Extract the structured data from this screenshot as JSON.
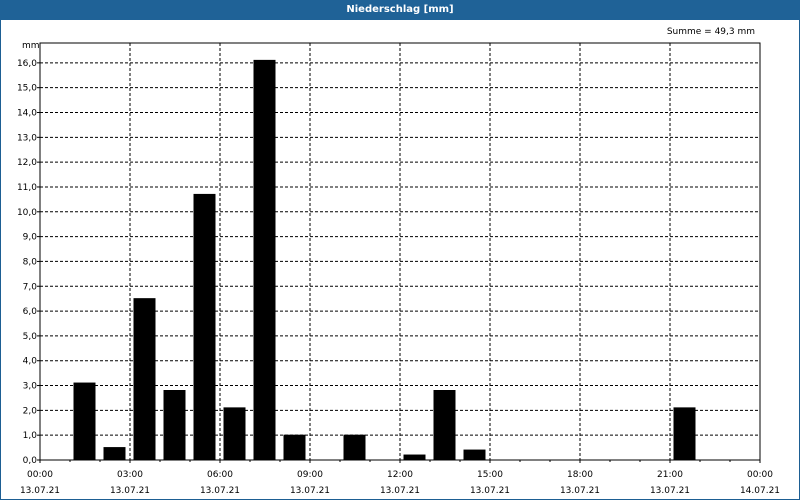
{
  "title": "Niederschlag [mm]",
  "summary": "Summe = 49,3 mm",
  "chart_data": {
    "type": "bar",
    "title": "Niederschlag [mm]",
    "ylabel": "mm",
    "xlabel": "",
    "ylim": [
      0,
      16.8
    ],
    "y_ticks": [
      "0,0",
      "1,0",
      "2,0",
      "3,0",
      "4,0",
      "5,0",
      "6,0",
      "7,0",
      "8,0",
      "9,0",
      "10,0",
      "11,0",
      "12,0",
      "13,0",
      "14,0",
      "15,0",
      "16,0"
    ],
    "x_ticks": [
      {
        "time": "00:00",
        "date": "13.07.21"
      },
      {
        "time": "03:00",
        "date": "13.07.21"
      },
      {
        "time": "06:00",
        "date": "13.07.21"
      },
      {
        "time": "09:00",
        "date": "13.07.21"
      },
      {
        "time": "12:00",
        "date": "13.07.21"
      },
      {
        "time": "15:00",
        "date": "13.07.21"
      },
      {
        "time": "18:00",
        "date": "13.07.21"
      },
      {
        "time": "21:00",
        "date": "13.07.21"
      },
      {
        "time": "00:00",
        "date": "14.07.21"
      }
    ],
    "categories": [
      "00:00",
      "01:00",
      "02:00",
      "03:00",
      "04:00",
      "05:00",
      "06:00",
      "07:00",
      "08:00",
      "09:00",
      "10:00",
      "11:00",
      "12:00",
      "13:00",
      "14:00",
      "15:00",
      "16:00",
      "17:00",
      "18:00",
      "19:00",
      "20:00",
      "21:00",
      "22:00",
      "23:00"
    ],
    "values": [
      0,
      3.1,
      0.5,
      6.5,
      2.8,
      10.7,
      2.1,
      16.1,
      1.0,
      0,
      1.0,
      0,
      0.2,
      2.8,
      0.4,
      0,
      0,
      0,
      0,
      0,
      0,
      2.1,
      0,
      0
    ],
    "grid": true,
    "colors": {
      "bar": "#000000",
      "title_bar": "#1f6297",
      "title_text": "#ffffff",
      "grid": "#000000"
    }
  }
}
